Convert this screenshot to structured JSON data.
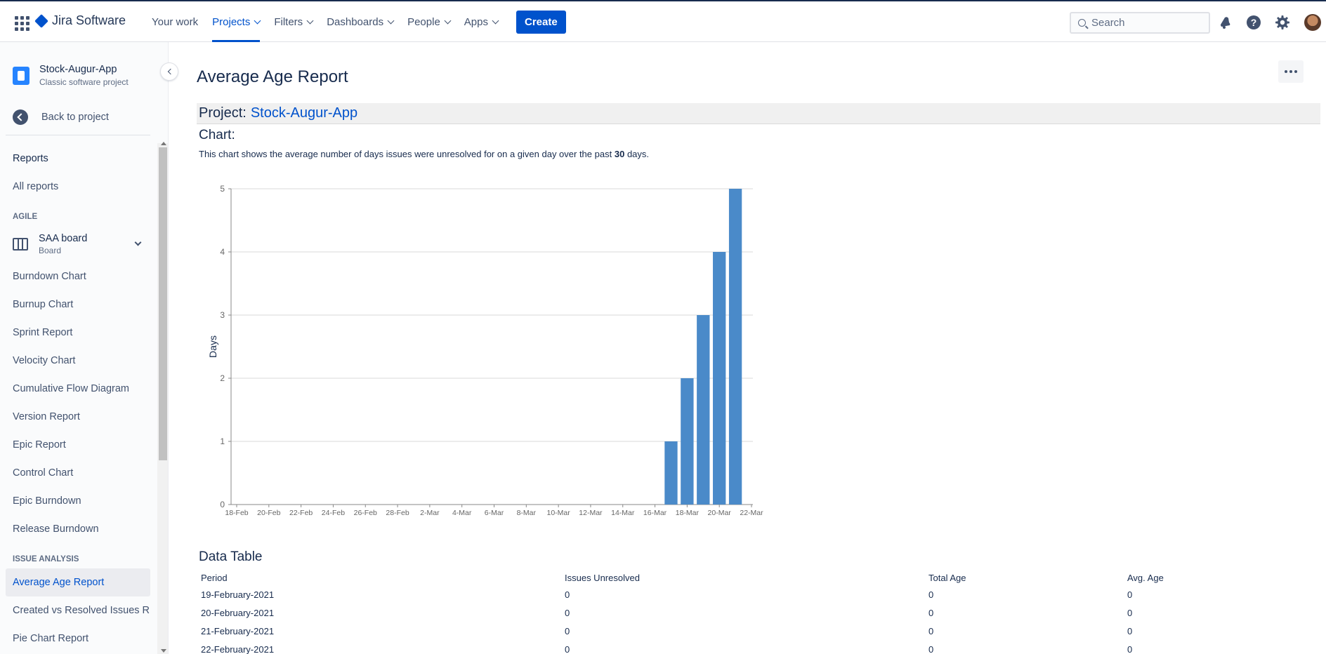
{
  "topbar": {
    "logo_text": "Jira Software",
    "nav": [
      {
        "label": "Your work",
        "dropdown": false,
        "active": false
      },
      {
        "label": "Projects",
        "dropdown": true,
        "active": true
      },
      {
        "label": "Filters",
        "dropdown": true,
        "active": false
      },
      {
        "label": "Dashboards",
        "dropdown": true,
        "active": false
      },
      {
        "label": "People",
        "dropdown": true,
        "active": false
      },
      {
        "label": "Apps",
        "dropdown": true,
        "active": false
      }
    ],
    "create_label": "Create",
    "search_placeholder": "Search",
    "icons": [
      "notifications-icon",
      "help-icon",
      "settings-icon",
      "profile-avatar"
    ],
    "accent_color": "#0052cc"
  },
  "sidebar": {
    "project_name": "Stock-Augur-App",
    "project_type": "Classic software project",
    "back_label": "Back to project",
    "reports_label": "Reports",
    "all_reports_label": "All reports",
    "agile_section": "AGILE",
    "board": {
      "name": "SAA board",
      "type": "Board"
    },
    "agile_items": [
      "Burndown Chart",
      "Burnup Chart",
      "Sprint Report",
      "Velocity Chart",
      "Cumulative Flow Diagram",
      "Version Report",
      "Epic Report",
      "Control Chart",
      "Epic Burndown",
      "Release Burndown"
    ],
    "issue_section": "ISSUE ANALYSIS",
    "issue_items": [
      "Average Age Report",
      "Created vs Resolved Issues R...",
      "Pie Chart Report"
    ],
    "active_item": "Average Age Report"
  },
  "main": {
    "title": "Average Age Report",
    "project_label": "Project:",
    "project_link": "Stock-Augur-App",
    "chart_heading": "Chart:",
    "desc_before": "This chart shows the average number of days issues were unresolved for on a given day over the past",
    "desc_days": "30",
    "desc_after": "days.",
    "data_heading": "Data Table",
    "table": {
      "columns": [
        "Period",
        "Issues Unresolved",
        "Total Age",
        "Avg. Age"
      ],
      "rows": [
        [
          "19-February-2021",
          "0",
          "0",
          "0"
        ],
        [
          "20-February-2021",
          "0",
          "0",
          "0"
        ],
        [
          "21-February-2021",
          "0",
          "0",
          "0"
        ],
        [
          "22-February-2021",
          "0",
          "0",
          "0"
        ]
      ]
    }
  },
  "chart_data": {
    "type": "bar",
    "ylabel": "Days",
    "xlabel": "",
    "ylim": [
      0,
      5
    ],
    "yticks": [
      "0",
      "1",
      "2",
      "3",
      "4",
      "5"
    ],
    "xticks": [
      "18-Feb",
      "20-Feb",
      "22-Feb",
      "24-Feb",
      "26-Feb",
      "28-Feb",
      "2-Mar",
      "4-Mar",
      "6-Mar",
      "8-Mar",
      "10-Mar",
      "12-Mar",
      "14-Mar",
      "16-Mar",
      "18-Mar",
      "20-Mar",
      "22-Mar"
    ],
    "categories": [
      "17-Mar",
      "18-Mar",
      "19-Mar",
      "20-Mar",
      "21-Mar"
    ],
    "values": [
      1,
      2,
      3,
      4,
      5
    ],
    "bar_color": "#4a8ac9",
    "grid": true
  }
}
